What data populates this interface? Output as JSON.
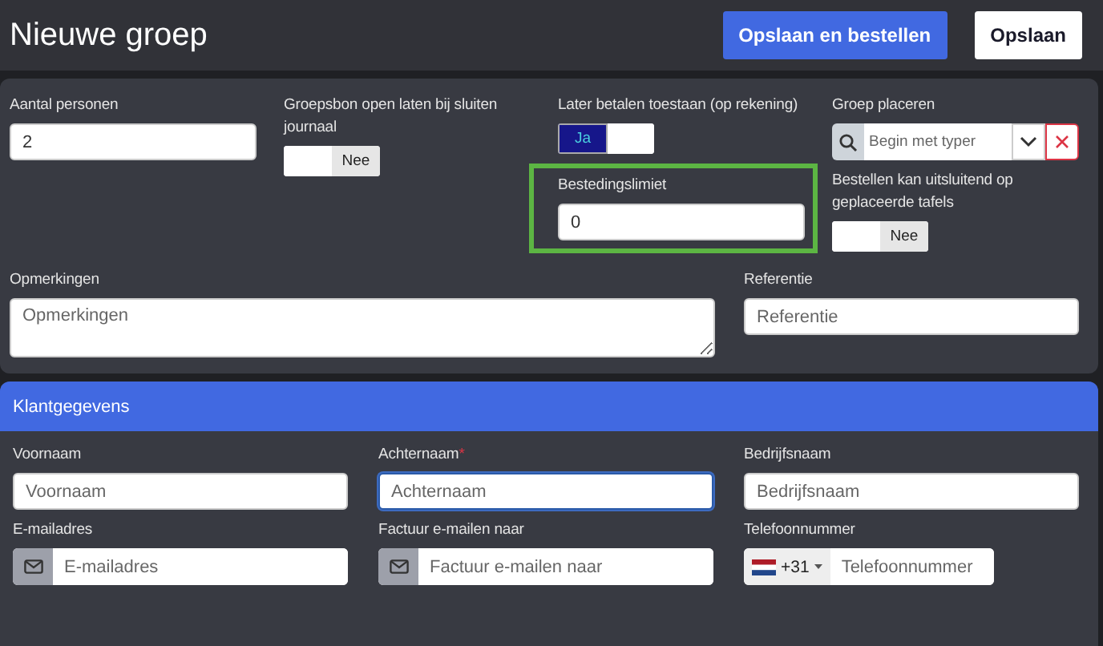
{
  "header": {
    "title": "Nieuwe groep",
    "buttons": [
      {
        "label": "Opslaan en bestellen",
        "kind": "primary"
      },
      {
        "label": "Opslaan",
        "kind": "secondary"
      }
    ]
  },
  "group_columns": [
    [
      {
        "kind": "input",
        "label": "Aantal personen",
        "value": "2",
        "highlighted": false
      }
    ],
    [
      {
        "kind": "toggle",
        "label": "Groepsbon open laten bij sluiten journaal",
        "on": false,
        "option": "Nee"
      }
    ],
    [
      {
        "kind": "toggle",
        "label": "Later betalen toestaan (op rekening)",
        "on": true,
        "option": "Ja"
      },
      {
        "kind": "input",
        "label": "Bestedingslimiet",
        "value": "0",
        "highlighted": true
      }
    ],
    [
      {
        "kind": "search-select",
        "label": "Groep placeren",
        "placeholder": "Begin met typer"
      },
      {
        "kind": "toggle",
        "label": "Bestellen kan uitsluitend op geplaceerde tafels",
        "on": false,
        "option": "Nee"
      }
    ]
  ],
  "remarks": [
    {
      "kind": "textarea",
      "label": "Opmerkingen",
      "placeholder": "Opmerkingen"
    },
    {
      "kind": "input",
      "label": "Referentie",
      "placeholder": "Referentie"
    }
  ],
  "customer": {
    "title": "Klantgegevens",
    "fields": [
      {
        "kind": "input",
        "label": "Voornaam",
        "placeholder": "Voornaam",
        "focused": false
      },
      {
        "kind": "input",
        "label": "Achternaam",
        "required_mark": "*",
        "placeholder": "Achternaam",
        "focused": true
      },
      {
        "kind": "input",
        "label": "Bedrijfsnaam",
        "placeholder": "Bedrijfsnaam",
        "focused": false
      },
      {
        "kind": "email",
        "label": "E-mailadres",
        "placeholder": "E-mailadres"
      },
      {
        "kind": "email",
        "label": "Factuur e-mailen naar",
        "placeholder": "Factuur e-mailen naar"
      },
      {
        "kind": "phone",
        "label": "Telefoonnummer",
        "dial_code": "+31",
        "placeholder": "Telefoonnummer"
      }
    ]
  }
}
